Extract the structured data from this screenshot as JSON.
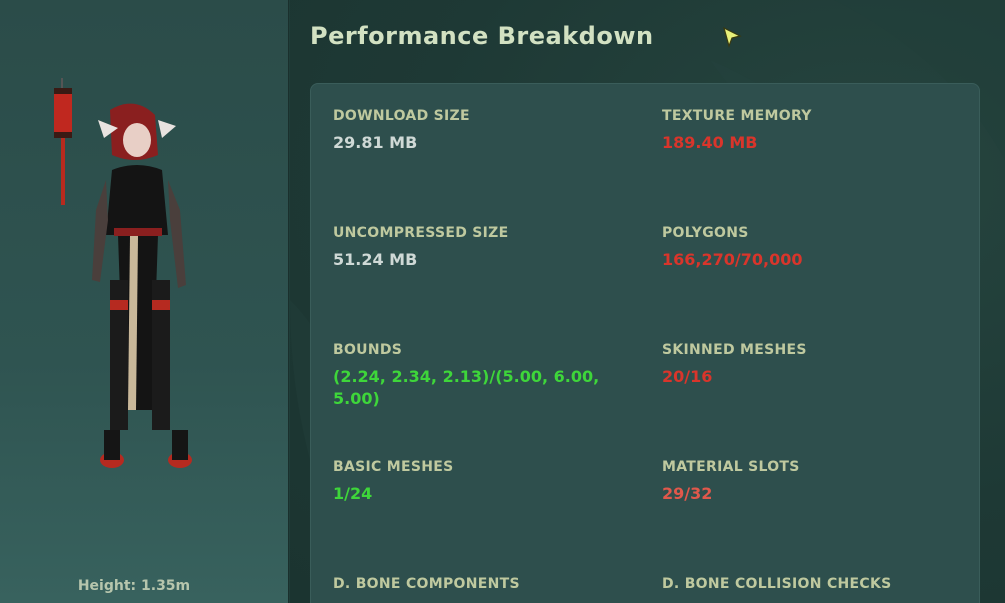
{
  "left_panel": {
    "height_label": "Height: 1.35m"
  },
  "header": {
    "title": "Performance Breakdown"
  },
  "stats": [
    {
      "label": "DOWNLOAD SIZE",
      "value": "29.81 MB",
      "status": "ok"
    },
    {
      "label": "TEXTURE MEMORY",
      "value": "189.40 MB",
      "status": "bad"
    },
    {
      "label": "UNCOMPRESSED SIZE",
      "value": "51.24 MB",
      "status": "ok"
    },
    {
      "label": "POLYGONS",
      "value": "166,270/70,000",
      "status": "bad"
    },
    {
      "label": "BOUNDS",
      "value": "(2.24, 2.34, 2.13)/(5.00, 6.00, 5.00)",
      "status": "good"
    },
    {
      "label": "SKINNED MESHES",
      "value": "20/16",
      "status": "bad"
    },
    {
      "label": "BASIC MESHES",
      "value": "1/24",
      "status": "good"
    },
    {
      "label": "MATERIAL SLOTS",
      "value": "29/32",
      "status": "warn"
    },
    {
      "label": "D. BONE COMPONENTS",
      "value": "",
      "status": "ok"
    },
    {
      "label": "D. BONE COLLISION CHECKS",
      "value": "",
      "status": "ok"
    }
  ],
  "colors": {
    "ok": "#cfd9d6",
    "bad": "#d9352b",
    "warn": "#e0584b",
    "good": "#3ed63a",
    "label": "#bfc99f",
    "title": "#d2e1c2"
  },
  "icons": {
    "cursor": "arrow-cursor-icon",
    "avatar": "avatar-preview"
  }
}
